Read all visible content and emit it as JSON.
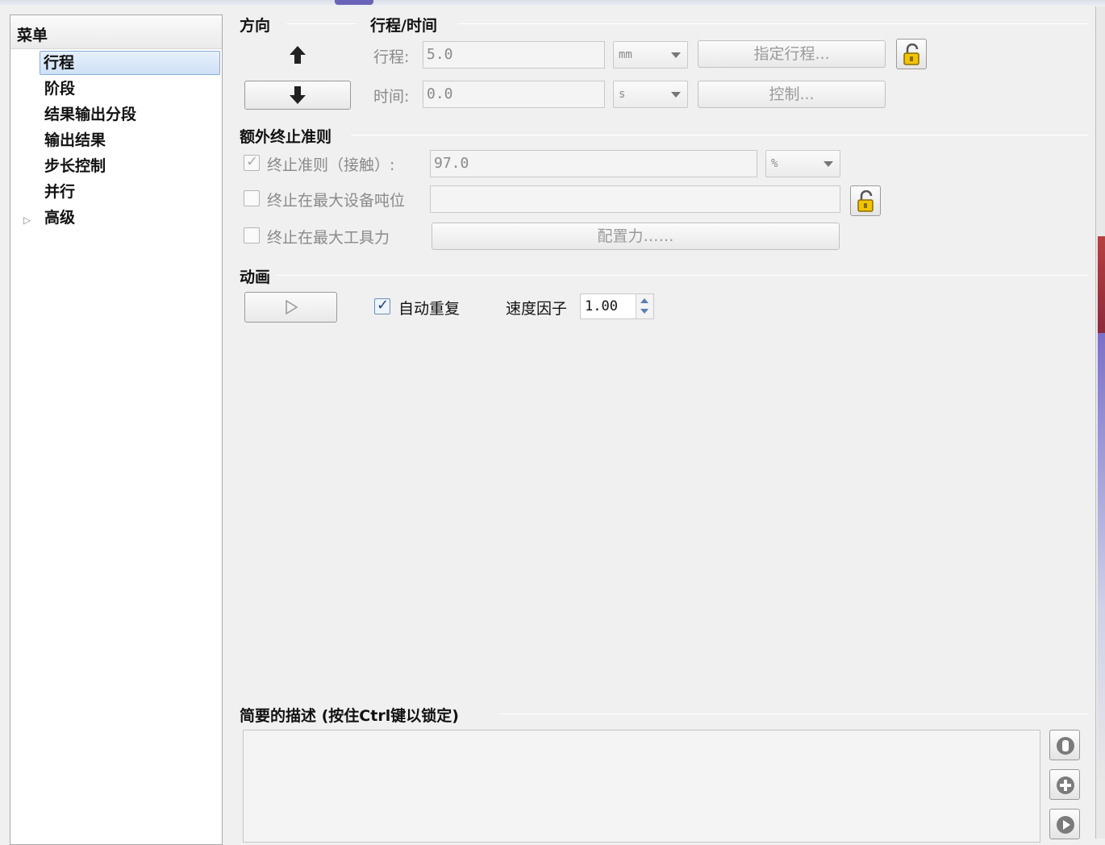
{
  "sidebar": {
    "header": "菜单",
    "items": [
      {
        "label": "行程"
      },
      {
        "label": "阶段"
      },
      {
        "label": "结果输出分段"
      },
      {
        "label": "输出结果"
      },
      {
        "label": "步长控制"
      },
      {
        "label": "并行"
      },
      {
        "label": "高级"
      }
    ]
  },
  "direction": {
    "title": "方向"
  },
  "stroke_time": {
    "title": "行程/时间",
    "stroke_label": "行程:",
    "stroke_value": "5.0",
    "stroke_unit": "mm",
    "specify_stroke_button": "指定行程...",
    "time_label": "时间:",
    "time_value": "0.0",
    "time_unit": "s",
    "control_button": "控制..."
  },
  "extra_criteria": {
    "title": "额外终止准则",
    "contact_label": "终止准则（接触）:",
    "contact_value": "97.0",
    "contact_unit": "%",
    "max_displacement_label": "终止在最大设备吨位",
    "max_force_label": "终止在最大工具力",
    "configure_force_button": "配置力……"
  },
  "animation": {
    "title": "动画",
    "auto_repeat_label": "自动重复",
    "speed_factor_label": "速度因子",
    "speed_factor_value": "1.00"
  },
  "description": {
    "title": "简要的描述 (按住Ctrl键以锁定)"
  },
  "colors": {
    "selection": "#cfe1f7",
    "selection_border": "#84acdd",
    "lock_yellow": "#f2c400"
  }
}
